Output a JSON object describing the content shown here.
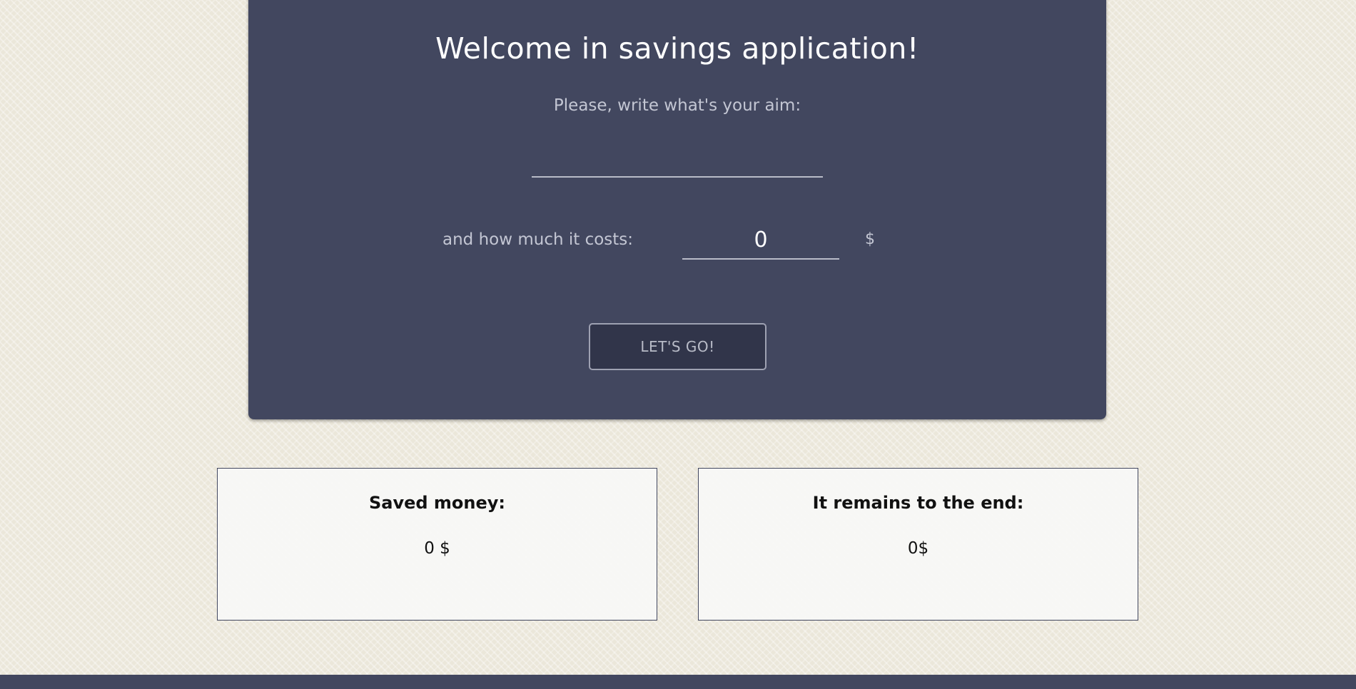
{
  "hero": {
    "title": "Welcome in savings application!",
    "prompt": "Please, write what's your aim:",
    "aim_value": "",
    "cost_label": "and how much it costs:",
    "cost_value": "0",
    "currency": "$",
    "go_button_label": "LET'S GO!"
  },
  "stats": {
    "saved": {
      "title": "Saved money:",
      "value": "0 $"
    },
    "remains": {
      "title": "It remains to the end:",
      "value": "0$"
    }
  },
  "colors": {
    "panel": "#42475f",
    "button": "#31354a",
    "background": "#ebe7da",
    "card": "#f7f8f6"
  }
}
